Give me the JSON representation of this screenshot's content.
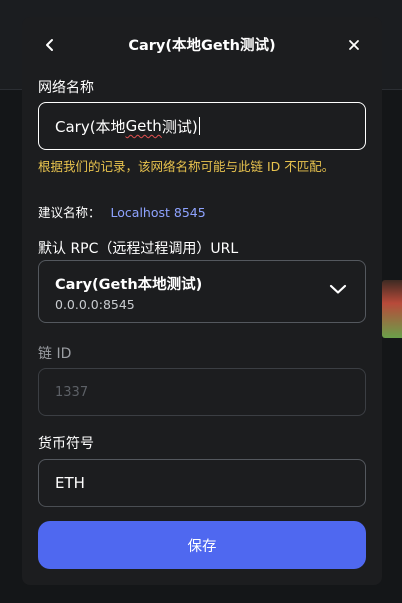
{
  "modal": {
    "title": "Cary(本地Geth测试)"
  },
  "network_name": {
    "label": "网络名称",
    "value": "Cary(本地Geth测试)",
    "value_prefix": "Cary(本地",
    "value_squiggle": "Geth",
    "value_suffix": "测试)"
  },
  "warning": {
    "text": "根据我们的记录，该网络名称可能与此链 ID 不匹配。"
  },
  "suggestion": {
    "label": "建议名称：",
    "value": "Localhost 8545"
  },
  "rpc": {
    "label": "默认 RPC（远程过程调用）URL",
    "selected_name": "Cary(Geth本地测试)",
    "selected_url": "0.0.0.0:8545"
  },
  "chain_id": {
    "label": "链 ID",
    "value": "1337"
  },
  "currency": {
    "label": "货币符号",
    "value": "ETH"
  },
  "save_button": {
    "label": "保存"
  },
  "colors": {
    "accent": "#4f68f0",
    "warning": "#e8c34e",
    "link": "#8ea3ff",
    "modal_bg": "#1c1d1f"
  },
  "icons": {
    "back": "arrow-left-icon",
    "close": "close-icon",
    "dropdown": "chevron-down-icon"
  }
}
